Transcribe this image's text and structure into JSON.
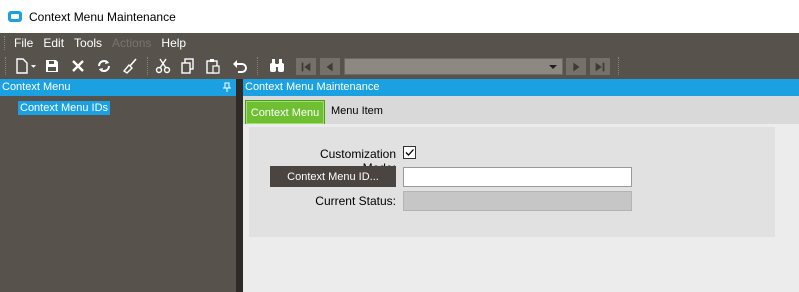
{
  "window": {
    "title": "Context Menu Maintenance"
  },
  "menubar": {
    "items": [
      {
        "label": "File",
        "enabled": true
      },
      {
        "label": "Edit",
        "enabled": true
      },
      {
        "label": "Tools",
        "enabled": true
      },
      {
        "label": "Actions",
        "enabled": false
      },
      {
        "label": "Help",
        "enabled": true
      }
    ]
  },
  "toolbar": {
    "icons": [
      "new-icon",
      "save-icon",
      "delete-icon",
      "refresh-icon",
      "clear-icon",
      "cut-icon",
      "copy-icon",
      "paste-icon",
      "undo-icon",
      "search-icon",
      "first-record-icon",
      "previous-record-icon",
      "next-record-icon",
      "last-record-icon"
    ],
    "record_selector_value": ""
  },
  "tree": {
    "header": "Context Menu",
    "nodes": [
      "Context Menu IDs"
    ]
  },
  "main": {
    "header": "Context Menu Maintenance",
    "tabs": [
      {
        "label": "Context Menu",
        "active": true
      },
      {
        "label": "Menu Item",
        "active": false
      }
    ],
    "form": {
      "customization_mode_label": "Customization Mode:",
      "customization_mode_checked": true,
      "context_menu_id_button": "Context Menu ID...",
      "context_menu_id_value": "",
      "current_status_label": "Current Status:",
      "current_status_value": ""
    }
  },
  "colors": {
    "accent": "#1ba1e2",
    "chrome": "#58524c",
    "active_tab": "#6fbf33"
  }
}
